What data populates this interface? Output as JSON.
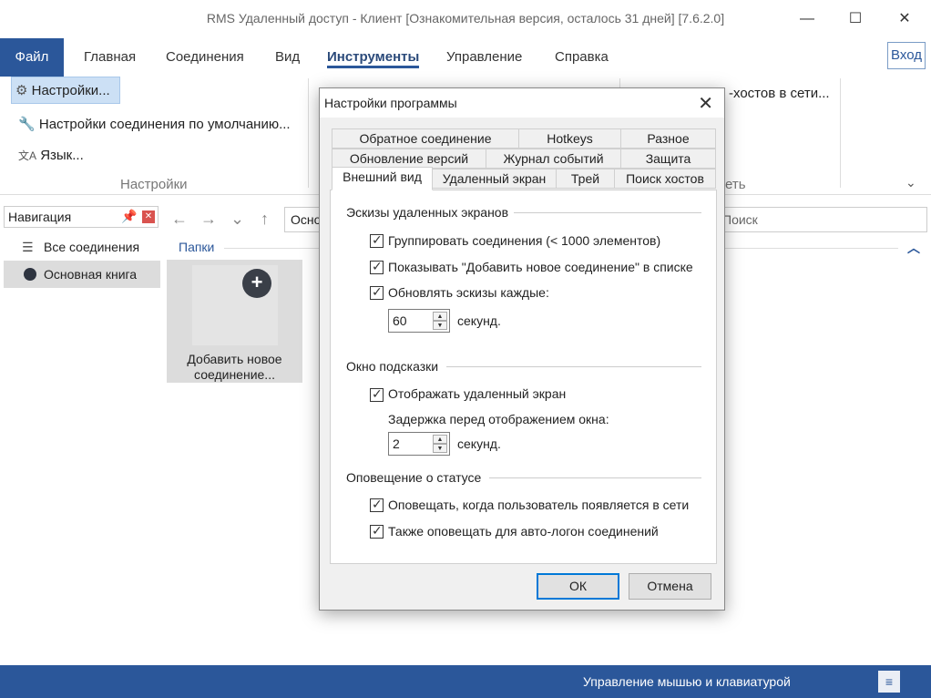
{
  "window": {
    "title": "RMS Удаленный доступ - Клиент [Ознакомительная версия, осталось 31 дней] [7.6.2.0]",
    "minimize": "—",
    "maximize": "☐",
    "close": "✕"
  },
  "menu": {
    "file": "Файл",
    "home": "Главная",
    "connections": "Соединения",
    "view": "Вид",
    "tools": "Инструменты",
    "management": "Управление",
    "help": "Справка",
    "login": "Вход"
  },
  "ribbon": {
    "settings": "Настройки...",
    "default_conn_settings": "Настройки соединения по умолчанию...",
    "language": "Язык...",
    "group_settings": "Настройки",
    "search_hosts": "-хостов в сети...",
    "group_partial": "еть"
  },
  "nav": {
    "title": "Навигация",
    "items": [
      {
        "label": "Все соединения"
      },
      {
        "label": "Основная книга"
      }
    ]
  },
  "toolbar": {
    "address": "Осно",
    "search_placeholder": "Поиск"
  },
  "content": {
    "folders_label": "Папки",
    "add_tile_label_1": "Добавить новое",
    "add_tile_label_2": "соединение..."
  },
  "status": {
    "text": "Управление мышью и клавиатурой"
  },
  "dialog": {
    "title": "Настройки программы",
    "tabs_row1": [
      "Обратное соединение",
      "Hotkeys",
      "Разное"
    ],
    "tabs_row2": [
      "Обновление версий",
      "Журнал событий",
      "Защита"
    ],
    "tabs_row3": [
      "Внешний вид",
      "Удаленный экран",
      "Трей",
      "Поиск хостов"
    ],
    "section1": {
      "title": "Эскизы удаленных экранов",
      "chk1": "Группировать соединения (< 1000 элементов)",
      "chk2": "Показывать \"Добавить новое соединение\" в списке",
      "chk3": "Обновлять эскизы каждые:",
      "spin_value": "60",
      "spin_unit": "секунд."
    },
    "section2": {
      "title": "Окно подсказки",
      "chk1": "Отображать удаленный экран",
      "delay_label": "Задержка перед отображением окна:",
      "spin_value": "2",
      "spin_unit": "секунд."
    },
    "section3": {
      "title": "Оповещение о статусе",
      "chk1": "Оповещать, когда пользователь появляется в сети",
      "chk2": "Также оповещать для авто-логон соединений"
    },
    "ok": "ОК",
    "cancel": "Отмена"
  }
}
